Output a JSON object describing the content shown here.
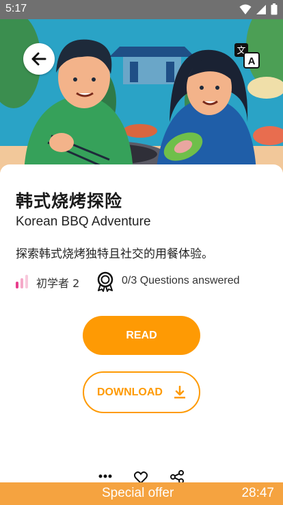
{
  "status_bar": {
    "time": "5:17"
  },
  "hero": {
    "image_icon": "illustration-couple-eating-korean-bbq"
  },
  "header": {
    "back_icon": "arrow-left-icon",
    "translate_icon": "translate-icon"
  },
  "story": {
    "title_zh": "韩式烧烤探险",
    "title_en": "Korean BBQ Adventure",
    "description": "探索韩式烧烤独特且社交的用餐体验。",
    "level_label": "初学者 2",
    "questions_label": "0/3 Questions answered"
  },
  "buttons": {
    "read_label": "READ",
    "download_label": "DOWNLOAD"
  },
  "offer": {
    "label": "Special offer",
    "timer": "28:47"
  },
  "colors": {
    "accent": "#fe9a04",
    "offer_bar": "#f5a340",
    "level_pink": "#e83e8c",
    "status_bar": "#707070"
  }
}
